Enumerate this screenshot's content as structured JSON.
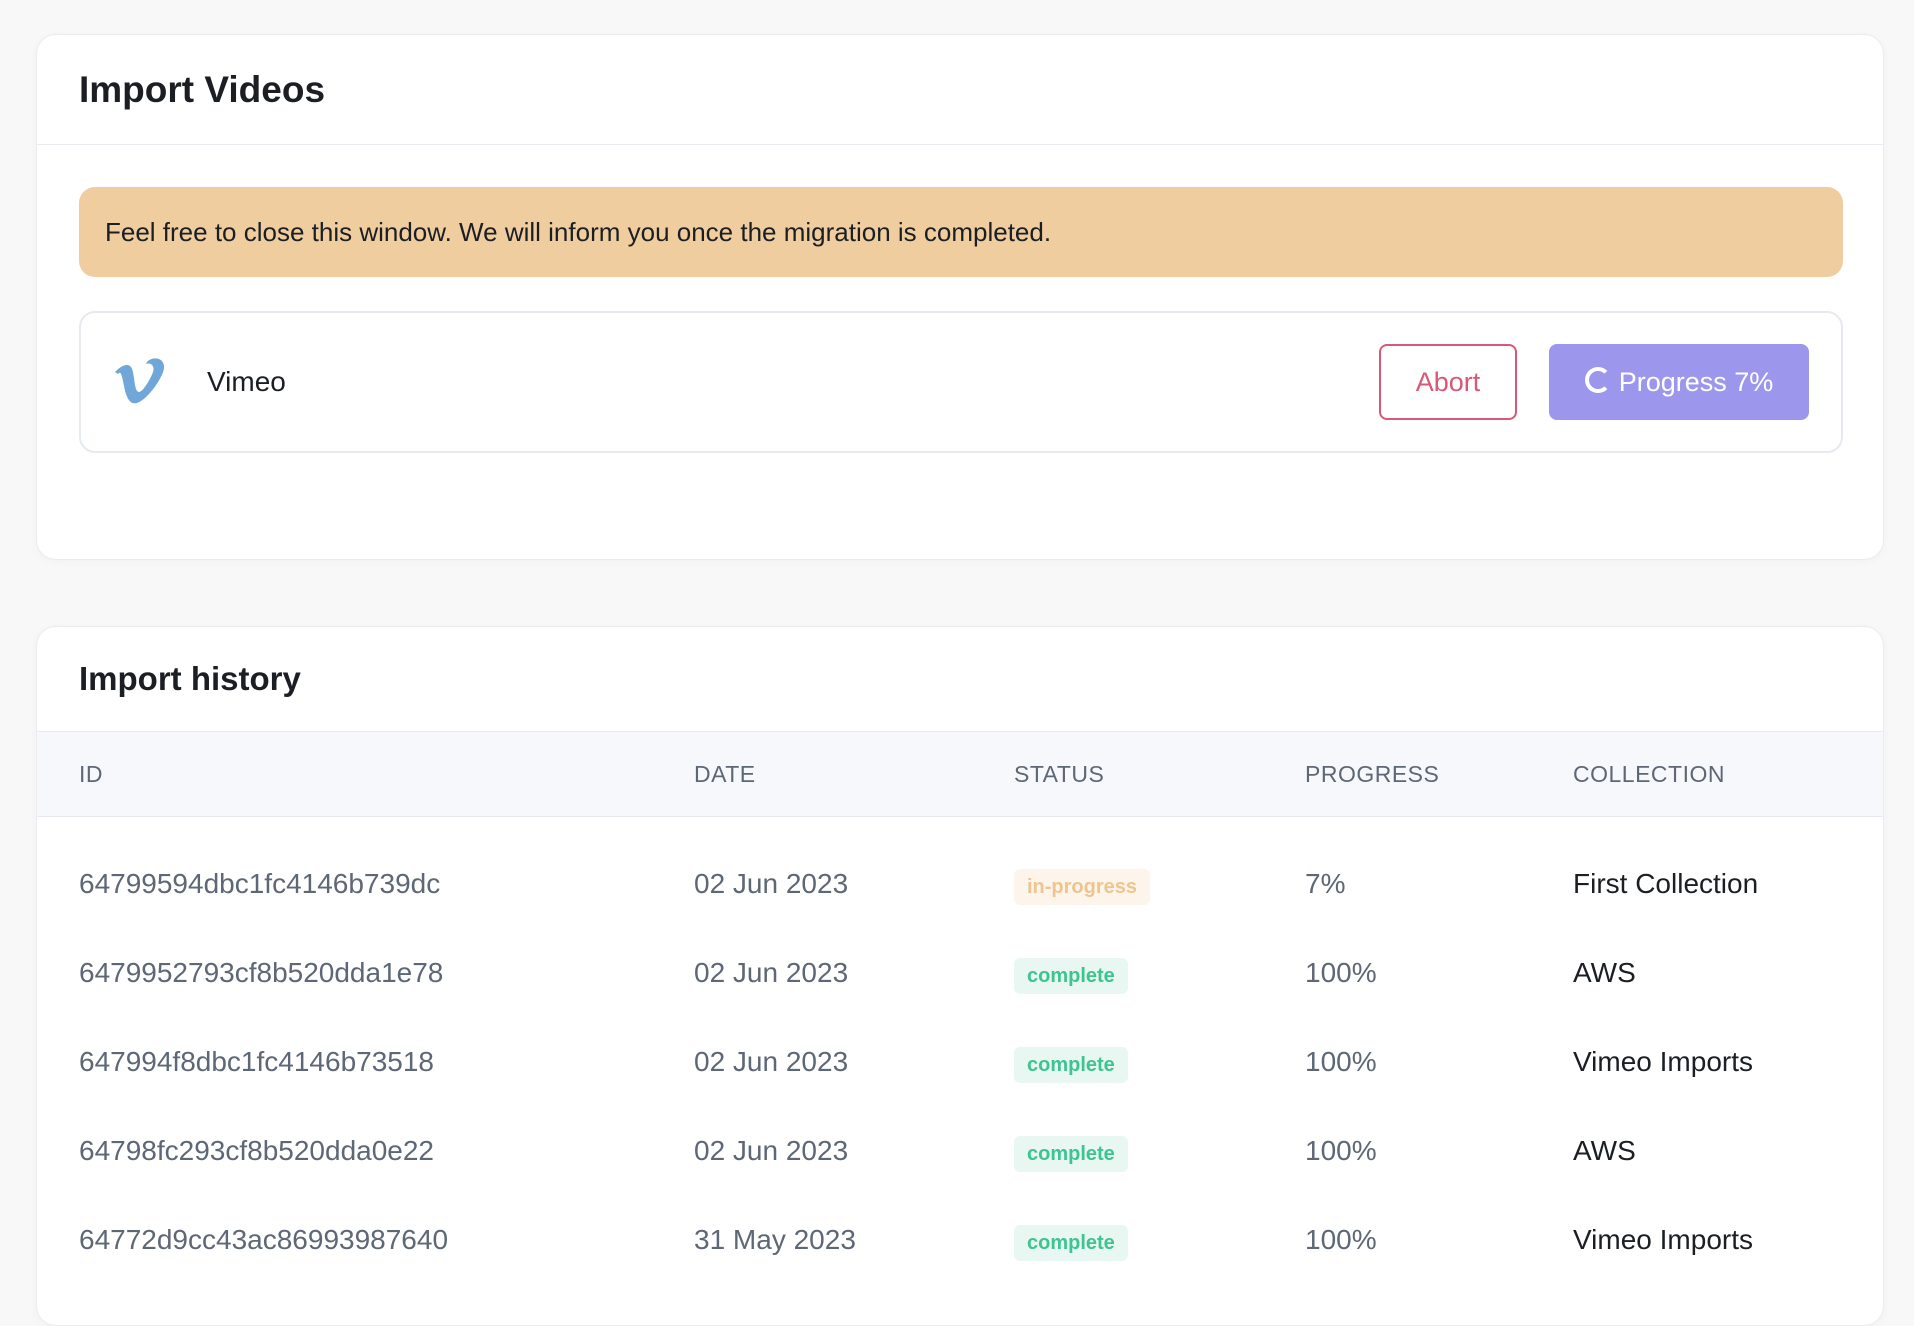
{
  "import_card": {
    "title": "Import Videos",
    "alert": "Feel free to close this window. We will inform you once the migration is completed.",
    "source": {
      "icon": "vimeo-icon",
      "name": "Vimeo",
      "abort_label": "Abort",
      "progress_label": "Progress 7%",
      "progress_percent": 7
    }
  },
  "history_card": {
    "title": "Import history",
    "columns": [
      "ID",
      "DATE",
      "STATUS",
      "PROGRESS",
      "COLLECTION"
    ],
    "rows": [
      {
        "id": "64799594dbc1fc4146b739dc",
        "date": "02 Jun 2023",
        "status": "in-progress",
        "progress": "7%",
        "collection": "First Collection"
      },
      {
        "id": "6479952793cf8b520dda1e78",
        "date": "02 Jun 2023",
        "status": "complete",
        "progress": "100%",
        "collection": "AWS"
      },
      {
        "id": "647994f8dbc1fc4146b73518",
        "date": "02 Jun 2023",
        "status": "complete",
        "progress": "100%",
        "collection": "Vimeo Imports"
      },
      {
        "id": "64798fc293cf8b520dda0e22",
        "date": "02 Jun 2023",
        "status": "complete",
        "progress": "100%",
        "collection": "AWS"
      },
      {
        "id": "64772d9cc43ac86993987640",
        "date": "31 May 2023",
        "status": "complete",
        "progress": "100%",
        "collection": "Vimeo Imports"
      }
    ]
  },
  "colors": {
    "alert_bg": "#efcd9f",
    "abort": "#d9587a",
    "progress_button": "#9c97ec",
    "vimeo_brand": "#6fa7d8",
    "badge_complete": "#3ec493",
    "badge_in_progress": "#eec58f"
  }
}
